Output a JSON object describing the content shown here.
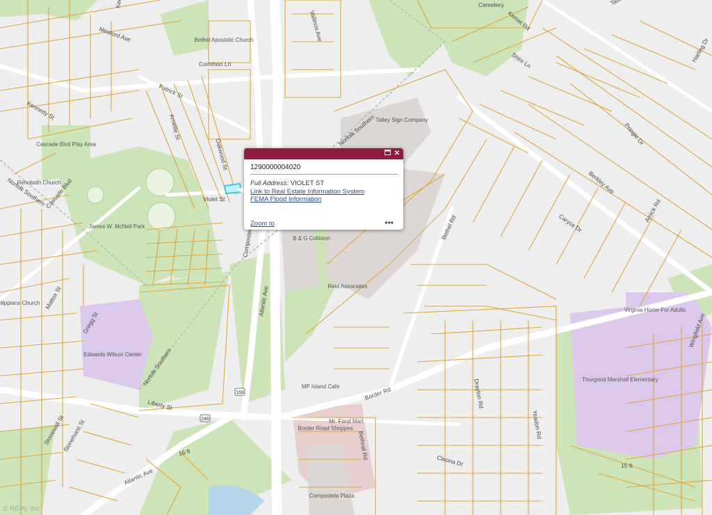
{
  "colors": {
    "background": "#eeeeee",
    "parcel_line": "#e0a63a",
    "green_area": "#cde4b8",
    "commercial_area": "#dcd6d4",
    "school_area": "#dcc8ea",
    "road": "#ffffff",
    "popup_header": "#8d1d3c",
    "link": "#2a4b8d",
    "selection": "#3ec9d8"
  },
  "popup": {
    "title": "1290000004020",
    "address_label": "Full Address:",
    "address_value": "VIOLET ST",
    "link_real_estate": "Link to Real Estate Information System",
    "link_fema": "FEMA Flood Information",
    "zoom_to": "Zoom to",
    "more_icon": "•••",
    "maximize_icon": "maximize-icon",
    "close_icon": "close-icon"
  },
  "map": {
    "streets": [
      "Keel",
      "Meaford Ave",
      "Common Ln",
      "Patrick St",
      "Kennedy St",
      "Arnette St",
      "Oakwood St",
      "Violet St",
      "Cascade Blvd",
      "Norfolk Southern",
      "Vallinos Ave",
      "Kemet Rd",
      "Tatum",
      "Shire Ln",
      "Harling Dr",
      "Pringle Dr",
      "Berkley Ave",
      "Caryce Dr",
      "Amick Rd",
      "Bethel Rd",
      "Compostela",
      "Atlantic Ave",
      "Norfolk Southern",
      "Mattox St",
      "Gregg St",
      "Norfolk Southern",
      "Liberty St",
      "Border Rd",
      "Drayton Rd",
      "Yeadon Rd",
      "Bethnal Rd",
      "Cleona Dr",
      "Wingfield Ave",
      "Stonewall St",
      "Stonehurst St",
      "Atlantic Ave",
      "Cemetery"
    ],
    "places": [
      "Bethel Apostolic Church",
      "Cascade Blvd Play Area",
      "Rehoboth Church",
      "James W. McNeil Park",
      "Talley Sign Company",
      "B & G Collision",
      "Reid Associates",
      "Virginia Home For Adults",
      "Edwards Wilson Center",
      "MP Island Cafe",
      "Border Road Shoppes",
      "Mr. Food Mart",
      "Thurgood Marshall Elementary",
      "Compostela Plaza",
      "Philippians Church"
    ],
    "route_shields": [
      "168",
      "246"
    ],
    "elevations": [
      "16 ft",
      "15 ft"
    ]
  },
  "copyright": "© REIN, Inc"
}
